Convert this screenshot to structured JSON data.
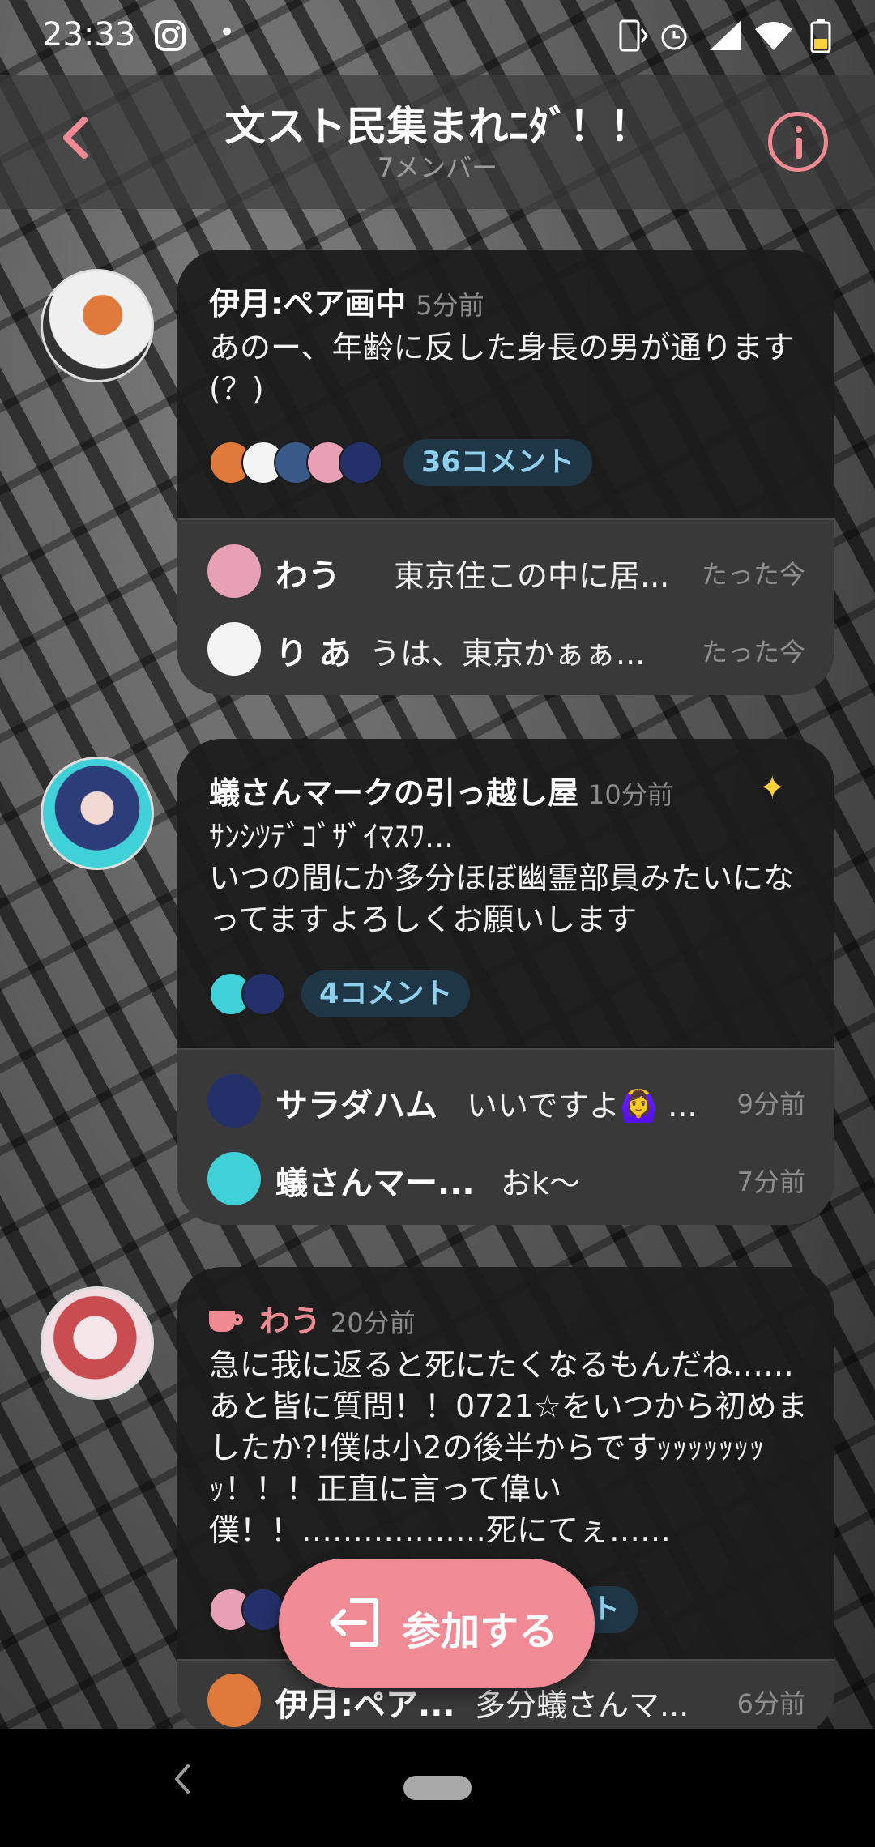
{
  "status_bar": {
    "time": "23:33",
    "icons": [
      "instagram-icon",
      "notification-dot-icon",
      "nfc-icon",
      "alarm-icon",
      "signal-icon",
      "wifi-icon",
      "battery-icon"
    ]
  },
  "header": {
    "title": "文スト民集まれﾆﾀﾞ！！",
    "subtitle": "7メンバー",
    "accent_color": "#ef8a93"
  },
  "posts": [
    {
      "author": "伊月:ペア画中",
      "time": "5分前",
      "body": "あのー、年齢に反した身長の男が通ります(？)",
      "comments_label": "36コメント",
      "replies": [
        {
          "name": "わう",
          "text": "東京住この中に居...",
          "time": "たった今"
        },
        {
          "name": "り あ",
          "text": "うは、東京かぁぁ...",
          "time": "たった今"
        }
      ]
    },
    {
      "author": "蟻さんマークの引っ越し屋",
      "time": "10分前",
      "body": "ｻﾝｼﾂﾃﾞｺﾞｻﾞｲﾏｽﾜ...\nいつの間にか多分ほぼ幽霊部員みたいになってますよろしくお願いします",
      "comments_label": "4コメント",
      "replies": [
        {
          "name": "サラダハム",
          "text": "いいですよ🙆‍♀️ ...",
          "time": "9分前"
        },
        {
          "name": "蟻さんマー...",
          "text": "おk〜",
          "time": "7分前"
        }
      ]
    },
    {
      "author": "わう",
      "time": "20分前",
      "body": "急に我に返ると死にたくなるもんだね……あと皆に質問！！0721☆をいつから初めましたか?!僕は小2の後半からですｯｯｯｯｯｯｯｯ！！！正直に言って偉い僕！！………………死にてぇ……",
      "comments_label": "ト",
      "replies": [
        {
          "name": "伊月:ペア...",
          "text": "多分蟻さんマ...",
          "time": "6分前"
        }
      ]
    }
  ],
  "join_button": {
    "label": "参加する"
  }
}
